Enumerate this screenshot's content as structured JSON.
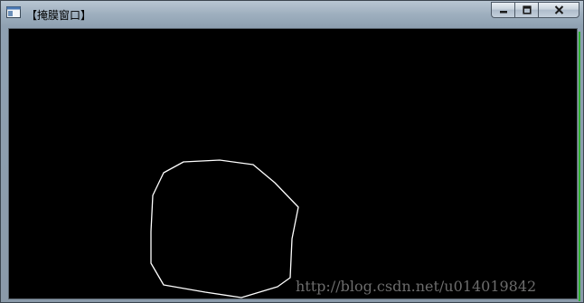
{
  "window": {
    "title": "【掩膜窗口】",
    "icon": "app-window-icon",
    "buttons": {
      "minimize": "minimize-icon",
      "maximize": "maximize-icon",
      "close": "close-icon"
    }
  },
  "canvas": {
    "background": "#000000",
    "shape": {
      "type": "closed-polyline",
      "stroke": "#ffffff"
    }
  },
  "watermark": {
    "text": "http://blog.csdn.net/u014019842"
  },
  "colors": {
    "title_bar": "#9fb0bf",
    "accent_edge": "#2fb02f"
  }
}
